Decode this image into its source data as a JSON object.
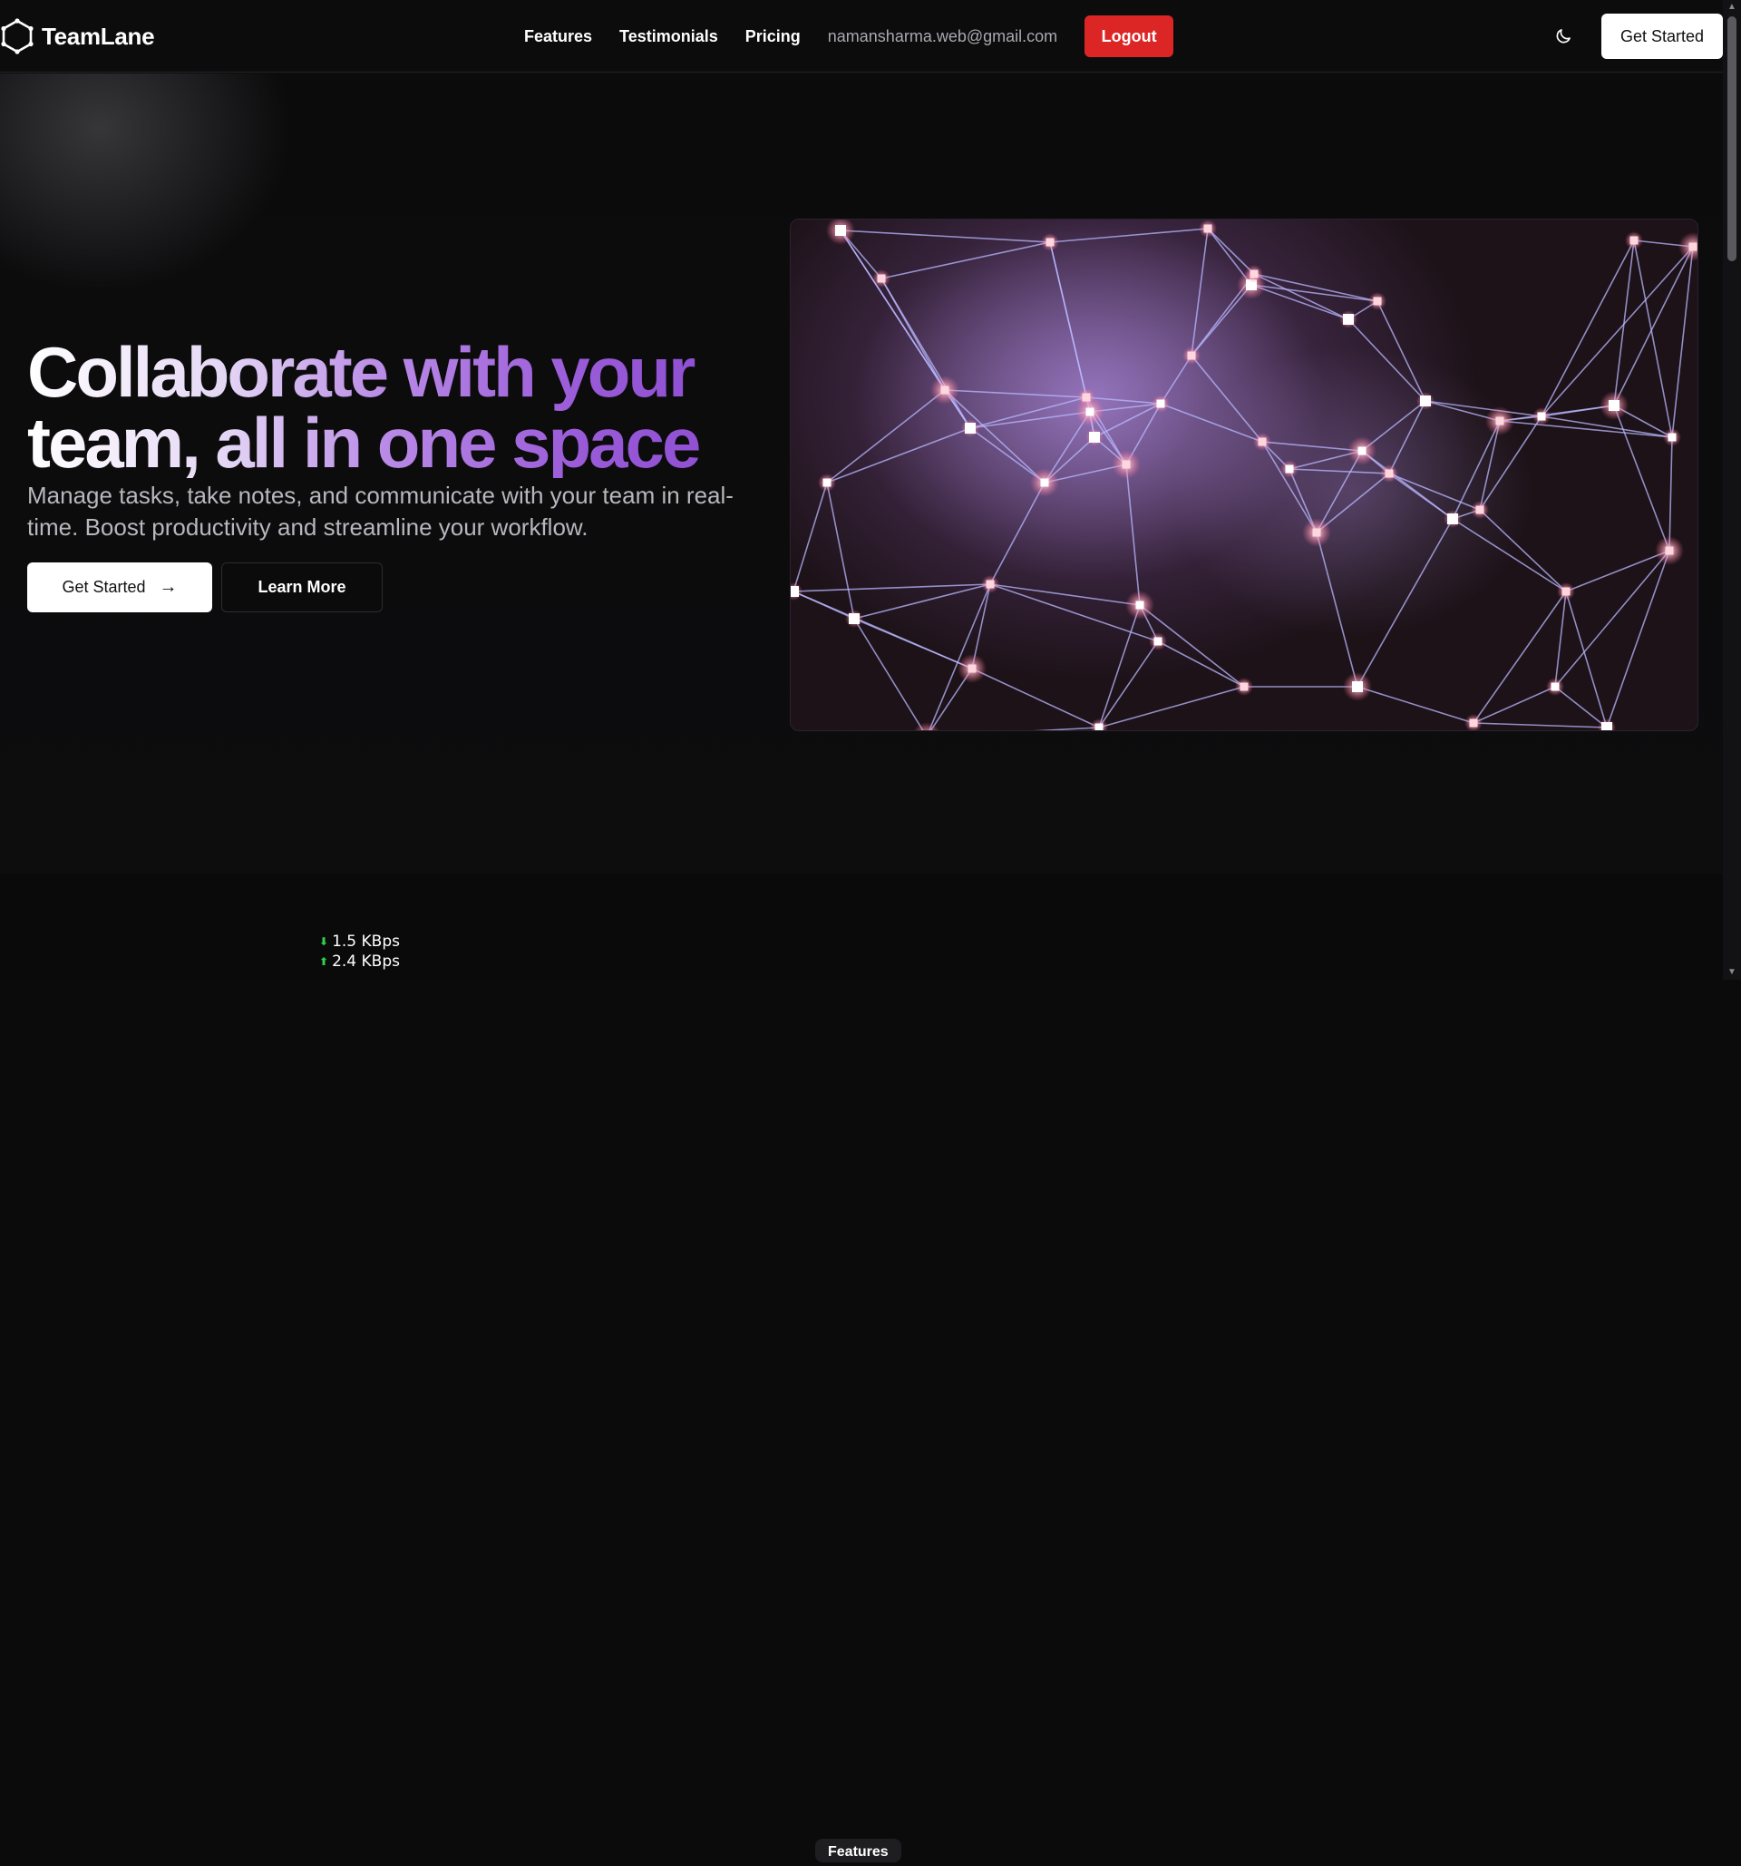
{
  "navbar": {
    "brand": "TeamLane",
    "links": [
      "Features",
      "Testimonials",
      "Pricing"
    ],
    "email": "namansharma.web@gmail.com",
    "logout_label": "Logout",
    "cta_label": "Get Started",
    "theme_icon": "moon-icon"
  },
  "hero": {
    "title": "Collaborate with your team, all in one space",
    "subtitle": "Manage tasks, take notes, and communicate with your team in real-time. Boost productivity and streamline your workflow.",
    "primary_label": "Get Started",
    "primary_icon": "arrow-right-icon",
    "secondary_label": "Learn More",
    "image_icon": "network-illustration"
  },
  "overlay": {
    "download": "1.5 KBps",
    "upload": "2.4 KBps"
  },
  "features_section": {
    "badge": "Features"
  },
  "colors": {
    "background": "#0b0b0c",
    "accent_purple": "#9a5bd8",
    "logout_red": "#dc2626"
  }
}
